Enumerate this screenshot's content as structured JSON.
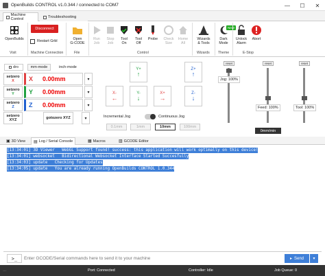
{
  "window": {
    "title": "OpenBuilds CONTROL v1.0.344 / connected to COM7",
    "minimize": "—",
    "maximize": "☐",
    "close": "✕"
  },
  "ribbon_tabs": [
    "Machine Control",
    "Troubleshooting"
  ],
  "ribbon": {
    "openbuilds": "OpenBuilds",
    "disconnect": "Disconnect",
    "restart": "Restart Grbl",
    "open": "Open\nG-CODE",
    "run": "Run\nJob",
    "stop": "Stop\nJob",
    "toolon": "Tool\nOn",
    "tooloff": "Tool\nOff",
    "probe": "Probe",
    "checksize": "Check\nSize",
    "homeall": "Home\nAll",
    "wizards": "Wizards\n& Tools",
    "darkmode": "Dark\nMode",
    "new_badge": "New!",
    "unlock": "Unlock\nAlarm",
    "abort": "Abort",
    "groups": [
      "Visit",
      "Machine Connection",
      "File",
      "Control",
      "Wizards",
      "Theme",
      "E-Stop"
    ]
  },
  "dro": {
    "tab_dro": "dro",
    "units": [
      "mm-mode",
      "inch-mode"
    ],
    "setzero": "setzero",
    "axes": [
      {
        "label": "X",
        "value": "0.00mm",
        "color": "#e04040"
      },
      {
        "label": "Y",
        "value": "0.00mm",
        "color": "#20a040"
      },
      {
        "label": "Z",
        "value": "0.00mm",
        "color": "#2060d0"
      }
    ],
    "setzero_xyz": "setzero XYZ",
    "gotozero_xyz": "gotozero XYZ",
    "setzero_xyz_axes": "XYZ",
    "gotozero_xyz_axes": "XYZ"
  },
  "jog": {
    "yplus": "Y+",
    "yminus": "Y-",
    "xplus": "X+",
    "xminus": "X-",
    "zplus": "Z+",
    "zminus": "Z-",
    "incremental": "Incremental Jog",
    "continuous": "Continuous Jog",
    "steps": [
      "0.1mm",
      "1mm",
      "10mm",
      "100mm"
    ],
    "selected_step": "10mm"
  },
  "overrides": {
    "reset": "reset",
    "jog": "Jog: 100%",
    "feed": "Feed: 100%",
    "tool": "Tool: 100%",
    "rpm": "0mm/min"
  },
  "lower_tabs": [
    "3D View",
    "Log / Serial Console",
    "Macros",
    "GCODE Editor"
  ],
  "console": [
    {
      "time": "[13:34:01]",
      "msg": " 3D Viewer   WebGL Support found! success: this application will work optimally on this device!"
    },
    {
      "time": "[13:34:01]",
      "msg": " websocket   Bidirectional Websocket Interface Started Succesfully"
    },
    {
      "time": "[13:34:03]",
      "msg": " update   Checking for Updates"
    },
    {
      "time": "[13:34:05]",
      "msg": " update   You are already running OpenBuilds CONTROL 1.0.344"
    }
  ],
  "cmd": {
    "prompt": ">_",
    "placeholder": "Enter GCODE/Serial commands here to send it to your machine",
    "send": "Send"
  },
  "status": {
    "port": "Port: Connected",
    "controller": "Controller: Idle",
    "queue": "Job Queue: 0"
  }
}
